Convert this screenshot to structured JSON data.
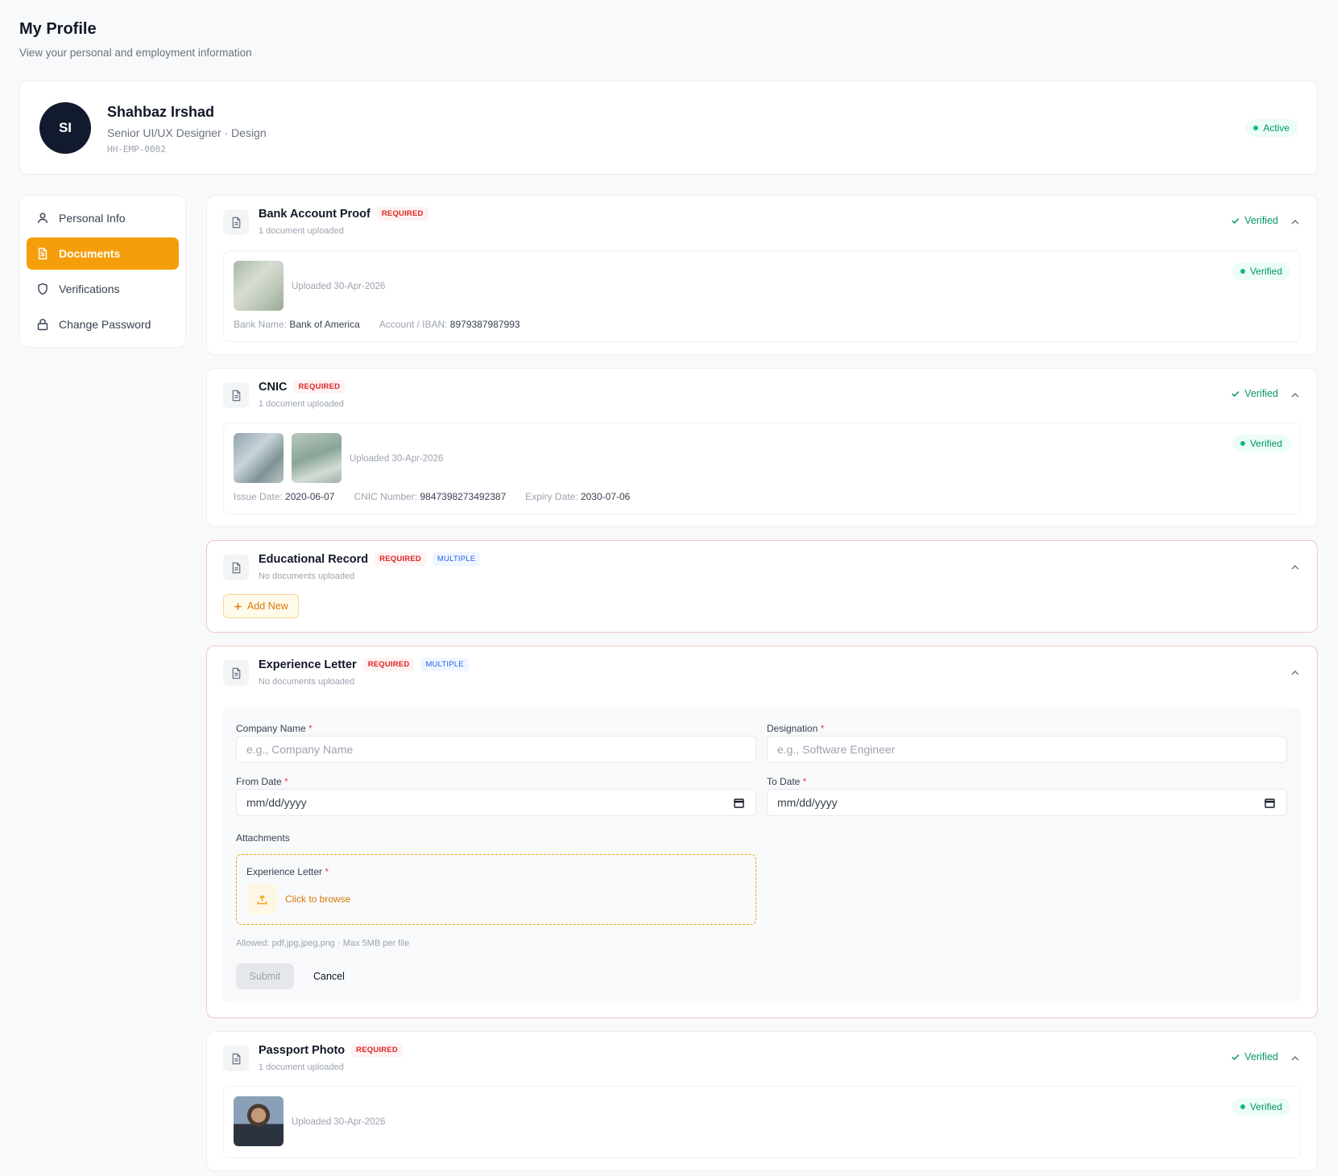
{
  "page": {
    "title": "My Profile",
    "subtitle": "View your personal and employment information"
  },
  "profile": {
    "initials": "SI",
    "name": "Shahbaz Irshad",
    "role": "Senior UI/UX Designer · Design",
    "code": "HH-EMP-0002",
    "status": "Active"
  },
  "sidebar": {
    "items": [
      {
        "label": "Personal Info",
        "icon": "user-icon"
      },
      {
        "label": "Documents",
        "icon": "document-icon",
        "active": true
      },
      {
        "label": "Verifications",
        "icon": "shield-icon"
      },
      {
        "label": "Change Password",
        "icon": "lock-icon"
      }
    ]
  },
  "labels": {
    "required": "REQUIRED",
    "multiple": "MULTIPLE",
    "verified": "Verified"
  },
  "sections": {
    "bank": {
      "title": "Bank Account Proof",
      "meta": "1 document uploaded",
      "status": "Verified",
      "uploaded": "Uploaded 30-Apr-2026",
      "doc_status": "Verified",
      "fields": [
        {
          "label": "Bank Name:",
          "value": "Bank of America"
        },
        {
          "label": "Account / IBAN:",
          "value": "8979387987993"
        }
      ]
    },
    "cnic": {
      "title": "CNIC",
      "meta": "1 document uploaded",
      "status": "Verified",
      "uploaded": "Uploaded 30-Apr-2026",
      "doc_status": "Verified",
      "fields": [
        {
          "label": "Issue Date:",
          "value": "2020-06-07"
        },
        {
          "label": "CNIC Number:",
          "value": "9847398273492387"
        },
        {
          "label": "Expiry Date:",
          "value": "2030-07-06"
        }
      ]
    },
    "education": {
      "title": "Educational Record",
      "meta": "No documents uploaded",
      "add_new": "Add New"
    },
    "experience": {
      "title": "Experience Letter",
      "meta": "No documents uploaded",
      "form": {
        "company_label": "Company Name",
        "company_placeholder": "e.g., Company Name",
        "designation_label": "Designation",
        "designation_placeholder": "e.g., Software Engineer",
        "from_label": "From Date",
        "from_value": "mm/dd/yyyy",
        "to_label": "To Date",
        "to_value": "mm/dd/yyyy",
        "attachments_label": "Attachments",
        "attach_title": "Experience Letter",
        "browse": "Click to browse",
        "allowed": "Allowed: pdf,jpg,jpeg,png · Max 5MB per file",
        "submit": "Submit",
        "cancel": "Cancel"
      }
    },
    "passport": {
      "title": "Passport Photo",
      "meta": "1 document uploaded",
      "status": "Verified",
      "uploaded": "Uploaded 30-Apr-2026",
      "doc_status": "Verified"
    }
  },
  "colors": {
    "accent": "#f59e0b",
    "verified": "#059669",
    "required": "#dc2626",
    "multiple": "#2563eb",
    "avatar_bg": "#111a2e"
  }
}
